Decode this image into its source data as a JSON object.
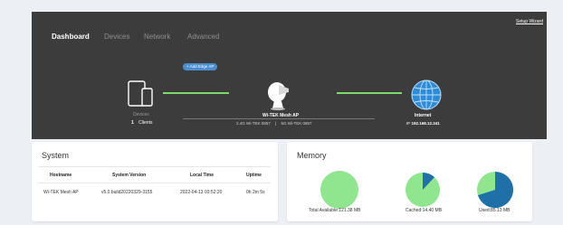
{
  "nav": {
    "tabs": [
      {
        "label": "Dashboard",
        "active": true
      },
      {
        "label": "Devices",
        "active": false
      },
      {
        "label": "Network",
        "active": false
      },
      {
        "label": "Advanced",
        "active": false
      }
    ],
    "setup_wizard": "Setup Wizard"
  },
  "topology": {
    "add_edge_ap": "+ Add Edge AP",
    "devices": {
      "icon": "phone-tablet-icon",
      "label": "Devices",
      "count": "1",
      "clients": "Clients"
    },
    "mesh": {
      "icon": "mesh-router-icon",
      "name": "Wi-TEK Mesh AP",
      "ssid_24": "2.4G Wi-TEK 0857",
      "separator": "|",
      "ssid_5": "5G Wi-TEK 0857"
    },
    "internet": {
      "icon": "globe-icon",
      "label": "Internet",
      "ip_label": "IP",
      "ip": "192.168.12.341"
    },
    "colors": {
      "link": "#7dd96b",
      "button": "#4a8ed0",
      "globe": "#2f8bd6"
    }
  },
  "system": {
    "title": "System",
    "columns": [
      "Hostname",
      "System Version",
      "Local Time",
      "Uptime"
    ],
    "rows": [
      [
        "Wi-TEK Mesh AP",
        "v5.0.build20220329-3155",
        "2022-04-13 03:52:20",
        "0h 2m 5s"
      ]
    ]
  },
  "memory": {
    "title": "Memory",
    "charts": [
      {
        "label": "Total Available:121.38 MB",
        "used_fraction": 0.0
      },
      {
        "label": "Cached:14.40 MB",
        "used_fraction": 0.12
      },
      {
        "label": "Used:85.13 MB",
        "used_fraction": 0.7
      }
    ],
    "colors": {
      "free": "#8fe68f",
      "used": "#1f6fa8"
    }
  }
}
